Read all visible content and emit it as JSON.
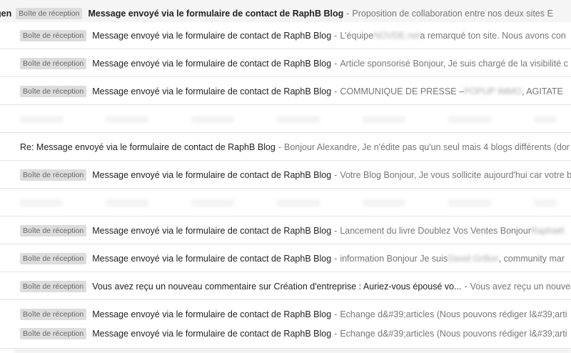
{
  "inbox": {
    "rows": [
      {
        "sender": "gen",
        "label": "Boîte de réception",
        "subject": "Message envoyé via le formulaire de contact de RaphB Blog",
        "snippet": "Proposition de collaboration entre nos deux sites E",
        "blur": "",
        "after": ""
      },
      {
        "label": "Boîte de réception",
        "subject": "Message envoyé via le formulaire de contact de RaphB Blog",
        "snippet": "L'équipe ",
        "blur": "NOVDE.net",
        "after": " a remarqué ton site. Nous avons con"
      },
      {
        "label": "Boîte de réception",
        "subject": "Message envoyé via le formulaire de contact de RaphB Blog",
        "snippet": "Article sponsorisé Bonjour, Je suis chargé de la visibilité c",
        "blur": "",
        "after": ""
      },
      {
        "label": "Boîte de réception",
        "subject": "Message envoyé via le formulaire de contact de RaphB Blog",
        "snippet": "COMMUNIQUE DE PRESSE – ",
        "blur": "POPUP IMMO",
        "after": ", AGITATE"
      },
      {
        "label": "",
        "subject": "",
        "snippet": "",
        "blur": "",
        "after": ""
      },
      {
        "label": "",
        "subject": "Re: Message envoyé via le formulaire de contact de RaphB Blog",
        "snippet": "Bonjour Alexandre, Je n'édite pas qu'un seul mais 4 blogs différents (dor",
        "blur": "",
        "after": ""
      },
      {
        "label": "Boîte de réception",
        "subject": "Message envoyé via le formulaire de contact de RaphB Blog",
        "snippet": "Votre Blog Bonjour, Je vous sollicite aujourd'hui car votre b",
        "blur": "",
        "after": ""
      },
      {
        "label": "",
        "subject": "",
        "snippet": "",
        "blur": "",
        "after": ""
      },
      {
        "label": "Boîte de réception",
        "subject": "Message envoyé via le formulaire de contact de RaphB Blog",
        "snippet": "Lancement du livre Doublez Vos Ventes Bonjour ",
        "blur": "Raphaël",
        "after": ""
      },
      {
        "label": "Boîte de réception",
        "subject": "Message envoyé via le formulaire de contact de RaphB Blog",
        "snippet": "information Bonjour Je suis ",
        "blur": "David Grillon",
        "after": ", community mar"
      },
      {
        "label": "Boîte de réception",
        "subject": "Vous avez reçu un nouveau commentaire sur Création d'entreprise : Auriez-vous épousé vo...",
        "snippet": "Vous avez reçu un nouveau",
        "blur": "",
        "after": ""
      },
      {
        "label": "Boîte de réception",
        "subject": "Message envoyé via le formulaire de contact de RaphB Blog",
        "snippet": "Echange d&#39;articles (Nous pouvons rédiger l&#39;arti",
        "blur": "",
        "after": ""
      },
      {
        "label": "Boîte de réception",
        "subject": "Message envoyé via le formulaire de contact de RaphB Blog",
        "snippet": "Echange d&#39;articles (Nous pouvons rédiger l&#39;arti",
        "blur": "",
        "after": ""
      }
    ],
    "dash": "-"
  }
}
